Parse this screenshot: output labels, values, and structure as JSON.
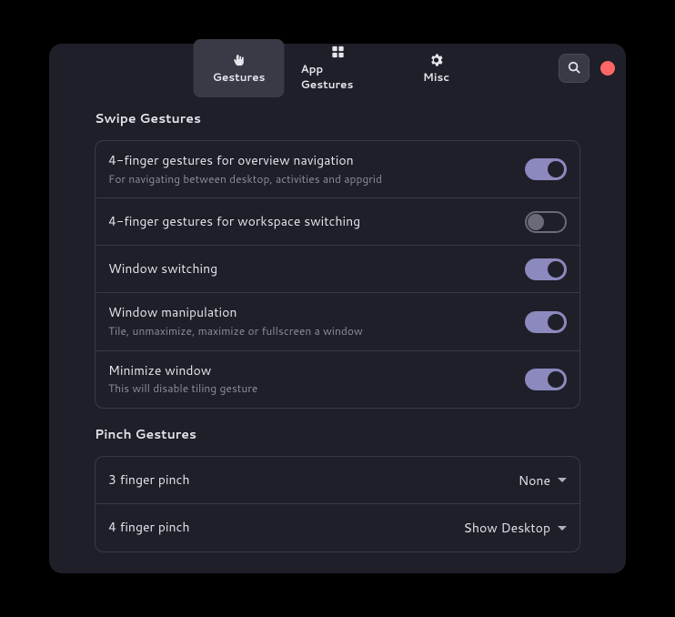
{
  "tabs": [
    {
      "label": "Gestures"
    },
    {
      "label": "App Gestures"
    },
    {
      "label": "Misc"
    }
  ],
  "sections": {
    "swipe": {
      "title": "Swipe Gestures",
      "rows": [
        {
          "title": "4-finger gestures for overview navigation",
          "sub": "For navigating between desktop, activities and appgrid",
          "on": true
        },
        {
          "title": "4-finger gestures for workspace switching",
          "sub": "",
          "on": false
        },
        {
          "title": "Window switching",
          "sub": "",
          "on": true
        },
        {
          "title": "Window manipulation",
          "sub": "Tile, unmaximize, maximize or fullscreen a window",
          "on": true
        },
        {
          "title": "Minimize window",
          "sub": "This will disable tiling gesture",
          "on": true
        }
      ]
    },
    "pinch": {
      "title": "Pinch Gestures",
      "rows": [
        {
          "title": "3 finger pinch",
          "value": "None"
        },
        {
          "title": "4 finger pinch",
          "value": "Show Desktop"
        }
      ]
    }
  }
}
